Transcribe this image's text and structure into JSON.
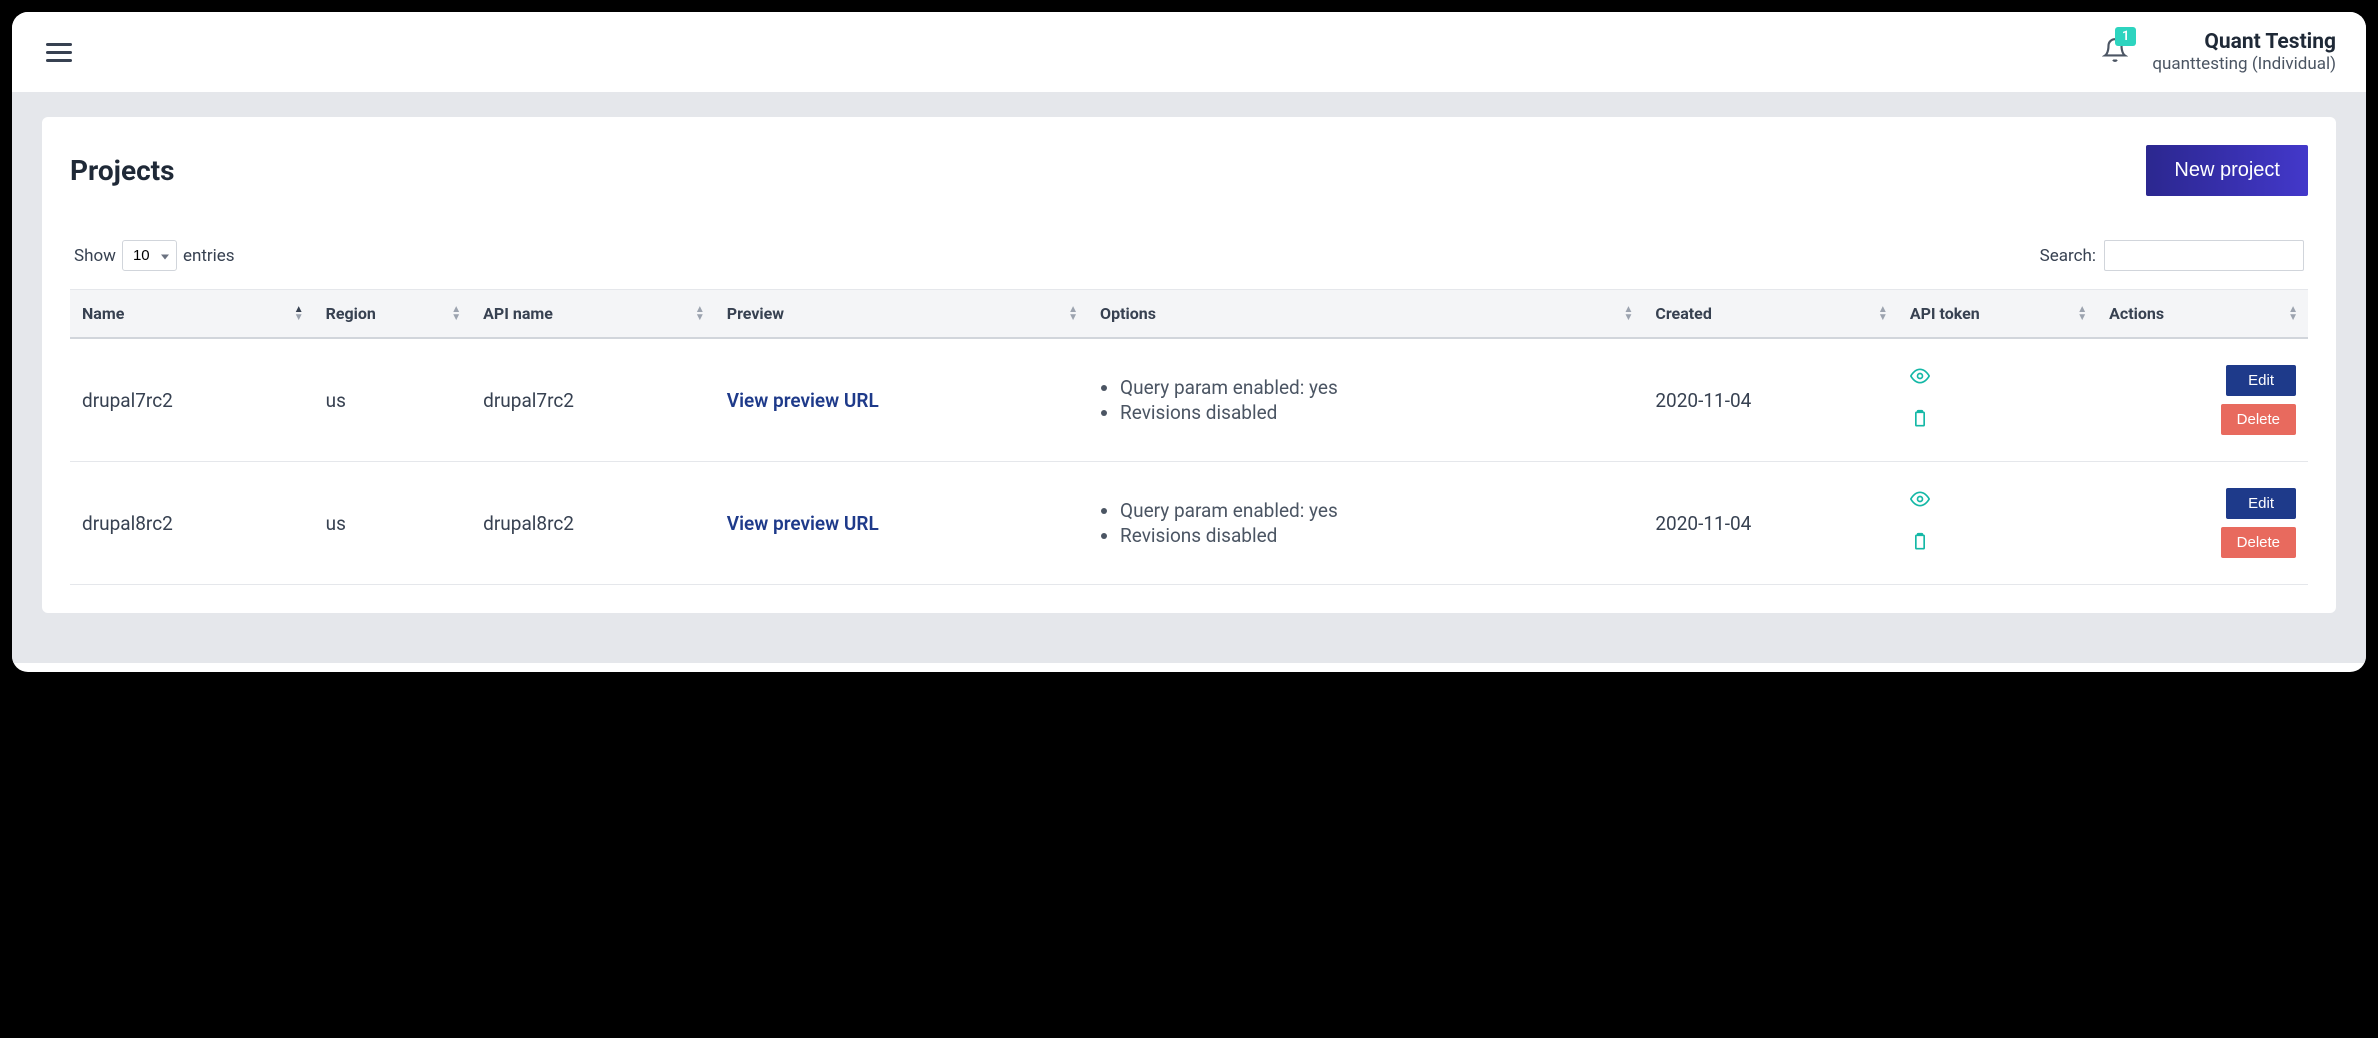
{
  "header": {
    "notification_count": "1",
    "account_name": "Quant Testing",
    "account_sub": "quanttesting (Individual)"
  },
  "page": {
    "title": "Projects",
    "new_project_label": "New project"
  },
  "table_controls": {
    "show_label": "Show",
    "entries_label": "entries",
    "show_value": "10",
    "search_label": "Search:",
    "search_value": ""
  },
  "columns": {
    "name": "Name",
    "region": "Region",
    "api_name": "API name",
    "preview": "Preview",
    "options": "Options",
    "created": "Created",
    "api_token": "API token",
    "actions": "Actions"
  },
  "rows": [
    {
      "name": "drupal7rc2",
      "region": "us",
      "api_name": "drupal7rc2",
      "preview_label": "View preview URL",
      "options": [
        "Query param enabled: yes",
        "Revisions disabled"
      ],
      "created": "2020-11-04",
      "edit_label": "Edit",
      "delete_label": "Delete"
    },
    {
      "name": "drupal8rc2",
      "region": "us",
      "api_name": "drupal8rc2",
      "preview_label": "View preview URL",
      "options": [
        "Query param enabled: yes",
        "Revisions disabled"
      ],
      "created": "2020-11-04",
      "edit_label": "Edit",
      "delete_label": "Delete"
    }
  ]
}
